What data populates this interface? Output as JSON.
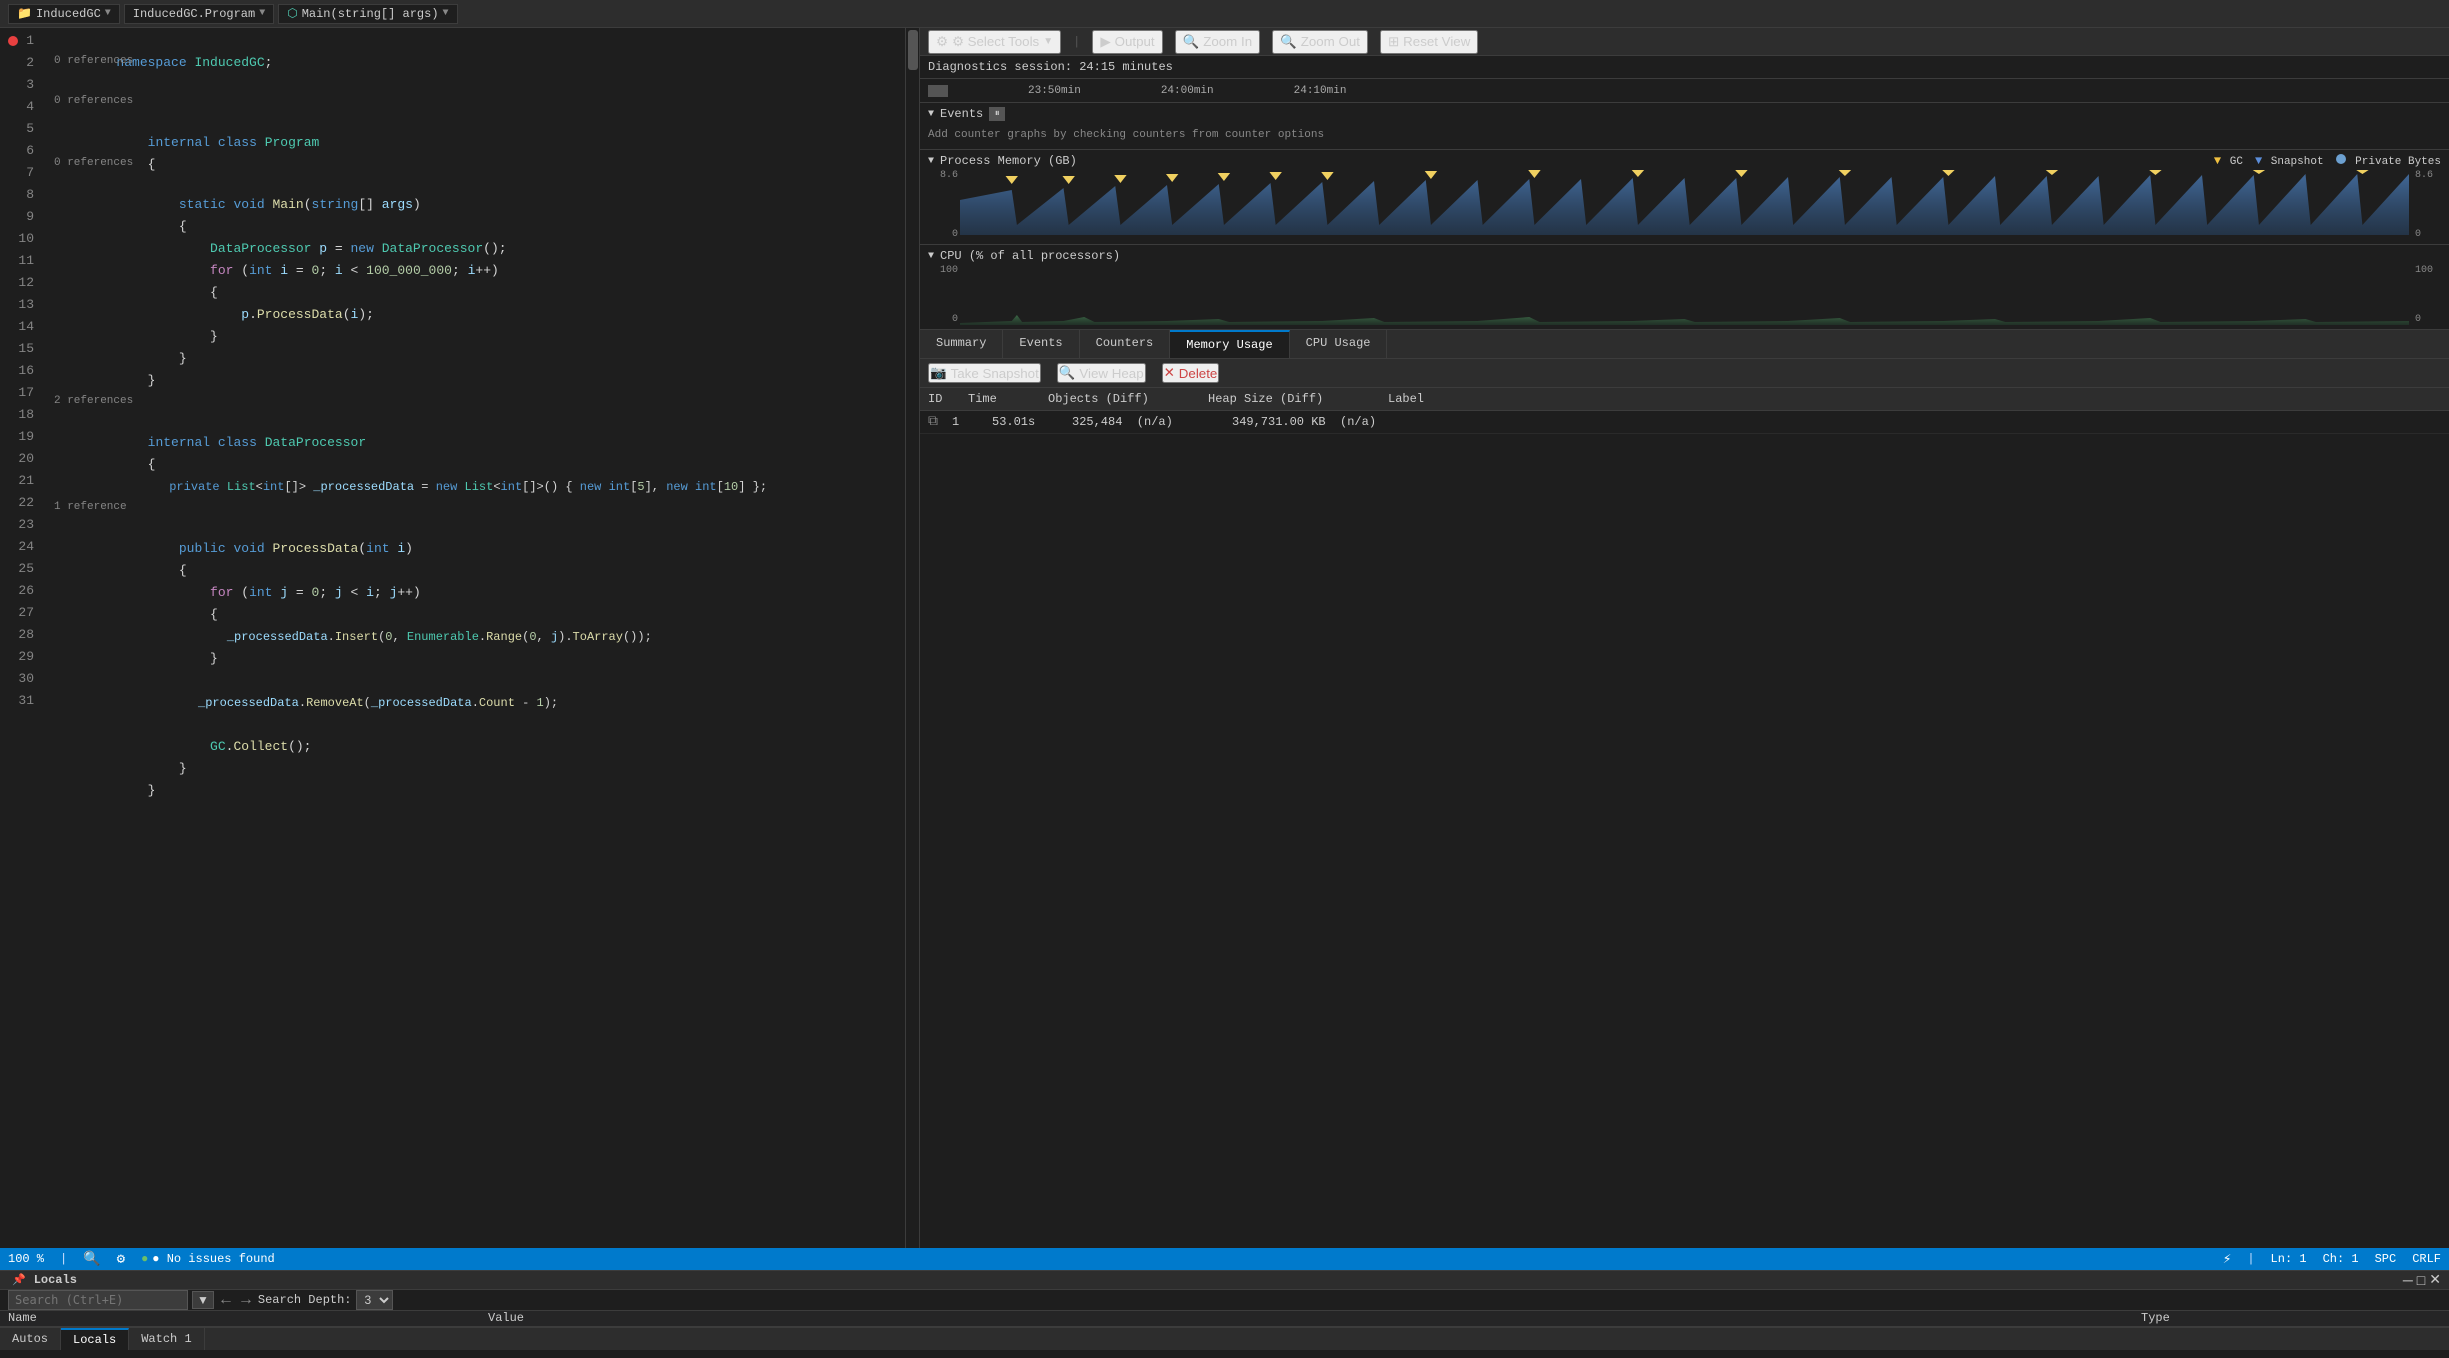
{
  "titlebar": {
    "project": "InducedGC",
    "file": "InducedGC.Program",
    "method": "Main(string[] args)"
  },
  "editor": {
    "lines": [
      {
        "num": 1,
        "tokens": [
          {
            "t": "kw",
            "v": "namespace"
          },
          {
            "t": "plain",
            "v": " "
          },
          {
            "t": "ns",
            "v": "InducedGC"
          },
          {
            "t": "plain",
            "v": ";"
          }
        ],
        "refs": null,
        "indent": 0
      },
      {
        "num": 2,
        "tokens": [],
        "refs": null
      },
      {
        "num": 3,
        "tokens": [
          {
            "t": "plain",
            "v": "    "
          },
          {
            "t": "kw",
            "v": "internal"
          },
          {
            "t": "plain",
            "v": " "
          },
          {
            "t": "kw",
            "v": "class"
          },
          {
            "t": "plain",
            "v": " "
          },
          {
            "t": "type",
            "v": "Program"
          }
        ],
        "refs": "0 references"
      },
      {
        "num": 4,
        "tokens": [
          {
            "t": "plain",
            "v": "    {"
          }
        ]
      },
      {
        "num": 5,
        "tokens": [
          {
            "t": "plain",
            "v": "        "
          },
          {
            "t": "kw",
            "v": "static"
          },
          {
            "t": "plain",
            "v": " "
          },
          {
            "t": "kw",
            "v": "void"
          },
          {
            "t": "plain",
            "v": " "
          },
          {
            "t": "method",
            "v": "Main"
          },
          {
            "t": "plain",
            "v": "("
          },
          {
            "t": "kw",
            "v": "string"
          },
          {
            "t": "plain",
            "v": "[] "
          },
          {
            "t": "param",
            "v": "args"
          },
          {
            "t": "plain",
            "v": ")"
          }
        ],
        "refs": "0 references"
      },
      {
        "num": 6,
        "tokens": [
          {
            "t": "plain",
            "v": "        {"
          }
        ]
      },
      {
        "num": 7,
        "tokens": [
          {
            "t": "plain",
            "v": "            "
          },
          {
            "t": "type",
            "v": "DataProcessor"
          },
          {
            "t": "plain",
            "v": " "
          },
          {
            "t": "param",
            "v": "p"
          },
          {
            "t": "plain",
            "v": " = "
          },
          {
            "t": "kw",
            "v": "new"
          },
          {
            "t": "plain",
            "v": " "
          },
          {
            "t": "type",
            "v": "DataProcessor"
          },
          {
            "t": "plain",
            "v": "();"
          }
        ]
      },
      {
        "num": 8,
        "tokens": [
          {
            "t": "plain",
            "v": "            "
          },
          {
            "t": "kw2",
            "v": "for"
          },
          {
            "t": "plain",
            "v": " ("
          },
          {
            "t": "kw",
            "v": "int"
          },
          {
            "t": "plain",
            "v": " "
          },
          {
            "t": "param",
            "v": "i"
          },
          {
            "t": "plain",
            "v": " = "
          },
          {
            "t": "num",
            "v": "0"
          },
          {
            "t": "plain",
            "v": "; "
          },
          {
            "t": "param",
            "v": "i"
          },
          {
            "t": "plain",
            "v": " < "
          },
          {
            "t": "num",
            "v": "100_000_000"
          },
          {
            "t": "plain",
            "v": "; "
          },
          {
            "t": "param",
            "v": "i"
          },
          {
            "t": "plain",
            "v": "++)"
          }
        ]
      },
      {
        "num": 9,
        "tokens": [
          {
            "t": "plain",
            "v": "            {"
          }
        ]
      },
      {
        "num": 10,
        "tokens": [
          {
            "t": "plain",
            "v": "                "
          },
          {
            "t": "param",
            "v": "p"
          },
          {
            "t": "plain",
            "v": "."
          },
          {
            "t": "method",
            "v": "ProcessData"
          },
          {
            "t": "plain",
            "v": "("
          },
          {
            "t": "param",
            "v": "i"
          },
          {
            "t": "plain",
            "v": ");"
          }
        ]
      },
      {
        "num": 11,
        "tokens": [
          {
            "t": "plain",
            "v": "            }"
          }
        ]
      },
      {
        "num": 12,
        "tokens": [
          {
            "t": "plain",
            "v": "        }"
          }
        ]
      },
      {
        "num": 13,
        "tokens": [
          {
            "t": "plain",
            "v": "    }"
          }
        ]
      },
      {
        "num": 14,
        "tokens": []
      },
      {
        "num": 15,
        "tokens": [
          {
            "t": "plain",
            "v": "    "
          },
          {
            "t": "kw",
            "v": "internal"
          },
          {
            "t": "plain",
            "v": " "
          },
          {
            "t": "kw",
            "v": "class"
          },
          {
            "t": "plain",
            "v": " "
          },
          {
            "t": "type",
            "v": "DataProcessor"
          }
        ],
        "refs": "2 references"
      },
      {
        "num": 16,
        "tokens": [
          {
            "t": "plain",
            "v": "    {"
          }
        ]
      },
      {
        "num": 17,
        "tokens": [
          {
            "t": "plain",
            "v": "        "
          },
          {
            "t": "kw",
            "v": "private"
          },
          {
            "t": "plain",
            "v": " "
          },
          {
            "t": "type",
            "v": "List"
          },
          {
            "t": "plain",
            "v": "<"
          },
          {
            "t": "kw",
            "v": "int"
          },
          {
            "t": "plain",
            "v": "[]> "
          },
          {
            "t": "param",
            "v": "_processedData"
          },
          {
            "t": "plain",
            "v": " = "
          },
          {
            "t": "kw",
            "v": "new"
          },
          {
            "t": "plain",
            "v": " "
          },
          {
            "t": "type",
            "v": "List"
          },
          {
            "t": "plain",
            "v": "<"
          },
          {
            "t": "kw",
            "v": "int"
          },
          {
            "t": "plain",
            "v": "[]>() { "
          },
          {
            "t": "kw",
            "v": "new"
          },
          {
            "t": "plain",
            "v": " "
          },
          {
            "t": "kw",
            "v": "int"
          },
          {
            "t": "plain",
            "v": "["
          },
          {
            "t": "num",
            "v": "5"
          },
          {
            "t": "plain",
            "v": "], "
          },
          {
            "t": "kw",
            "v": "new"
          },
          {
            "t": "plain",
            "v": " "
          },
          {
            "t": "kw",
            "v": "int"
          },
          {
            "t": "plain",
            "v": "["
          },
          {
            "t": "num",
            "v": "10"
          },
          {
            "t": "plain",
            "v": "] };"
          }
        ]
      },
      {
        "num": 18,
        "tokens": []
      },
      {
        "num": 19,
        "tokens": [
          {
            "t": "plain",
            "v": "        "
          },
          {
            "t": "kw",
            "v": "public"
          },
          {
            "t": "plain",
            "v": " "
          },
          {
            "t": "kw",
            "v": "void"
          },
          {
            "t": "plain",
            "v": " "
          },
          {
            "t": "method",
            "v": "ProcessData"
          },
          {
            "t": "plain",
            "v": "("
          },
          {
            "t": "kw",
            "v": "int"
          },
          {
            "t": "plain",
            "v": " "
          },
          {
            "t": "param",
            "v": "i"
          },
          {
            "t": "plain",
            "v": ")"
          }
        ],
        "refs": "1 reference"
      },
      {
        "num": 20,
        "tokens": [
          {
            "t": "plain",
            "v": "        {"
          }
        ]
      },
      {
        "num": 21,
        "tokens": [
          {
            "t": "plain",
            "v": "            "
          },
          {
            "t": "kw2",
            "v": "for"
          },
          {
            "t": "plain",
            "v": " ("
          },
          {
            "t": "kw",
            "v": "int"
          },
          {
            "t": "plain",
            "v": " "
          },
          {
            "t": "param",
            "v": "j"
          },
          {
            "t": "plain",
            "v": " = "
          },
          {
            "t": "num",
            "v": "0"
          },
          {
            "t": "plain",
            "v": "; "
          },
          {
            "t": "param",
            "v": "j"
          },
          {
            "t": "plain",
            "v": " < "
          },
          {
            "t": "param",
            "v": "i"
          },
          {
            "t": "plain",
            "v": "; "
          },
          {
            "t": "param",
            "v": "j"
          },
          {
            "t": "plain",
            "v": "++)"
          }
        ]
      },
      {
        "num": 22,
        "tokens": [
          {
            "t": "plain",
            "v": "            {"
          }
        ]
      },
      {
        "num": 23,
        "tokens": [
          {
            "t": "plain",
            "v": "                "
          },
          {
            "t": "param",
            "v": "_processedData"
          },
          {
            "t": "plain",
            "v": "."
          },
          {
            "t": "method",
            "v": "Insert"
          },
          {
            "t": "plain",
            "v": "("
          },
          {
            "t": "num",
            "v": "0"
          },
          {
            "t": "plain",
            "v": ", "
          },
          {
            "t": "type",
            "v": "Enumerable"
          },
          {
            "t": "plain",
            "v": "."
          },
          {
            "t": "method",
            "v": "Range"
          },
          {
            "t": "plain",
            "v": "("
          },
          {
            "t": "num",
            "v": "0"
          },
          {
            "t": "plain",
            "v": ", "
          },
          {
            "t": "param",
            "v": "j"
          },
          {
            "t": "plain",
            "v": ")."
          },
          {
            "t": "method",
            "v": "ToArray"
          },
          {
            "t": "plain",
            "v": "());"
          }
        ]
      },
      {
        "num": 24,
        "tokens": [
          {
            "t": "plain",
            "v": "            }"
          }
        ]
      },
      {
        "num": 25,
        "tokens": []
      },
      {
        "num": 26,
        "tokens": [
          {
            "t": "plain",
            "v": "            "
          },
          {
            "t": "param",
            "v": "_processedData"
          },
          {
            "t": "plain",
            "v": "."
          },
          {
            "t": "method",
            "v": "RemoveAt"
          },
          {
            "t": "plain",
            "v": "("
          },
          {
            "t": "param",
            "v": "_processedData"
          },
          {
            "t": "plain",
            "v": "."
          },
          {
            "t": "method",
            "v": "Count"
          },
          {
            "t": "plain",
            "v": " - "
          },
          {
            "t": "num",
            "v": "1"
          },
          {
            "t": "plain",
            "v": ");"
          }
        ]
      },
      {
        "num": 27,
        "tokens": []
      },
      {
        "num": 28,
        "tokens": [
          {
            "t": "plain",
            "v": "            "
          },
          {
            "t": "type",
            "v": "GC"
          },
          {
            "t": "plain",
            "v": "."
          },
          {
            "t": "method",
            "v": "Collect"
          },
          {
            "t": "plain",
            "v": "();"
          }
        ]
      },
      {
        "num": 29,
        "tokens": [
          {
            "t": "plain",
            "v": "        }"
          }
        ]
      },
      {
        "num": 30,
        "tokens": [
          {
            "t": "plain",
            "v": "    }"
          }
        ]
      },
      {
        "num": 31,
        "tokens": []
      }
    ]
  },
  "diag": {
    "toolbar": {
      "select_tools": "⚙ Select Tools",
      "output": "▶ Output",
      "zoom_in": "🔍 Zoom In",
      "zoom_out": "🔍 Zoom Out",
      "reset_view": "⊞ Reset View"
    },
    "session_label": "Diagnostics session: 24:15 minutes",
    "timeline": {
      "t1": "23:50min",
      "t2": "24:00min",
      "t3": "24:10min"
    },
    "events": {
      "header": "Events",
      "hint": "Add counter graphs by checking counters from counter options"
    },
    "process_memory": {
      "header": "Process Memory (GB)",
      "legend_gc": "GC",
      "legend_snapshot": "Snapshot",
      "legend_private": "Private Bytes",
      "max_val": "8.6",
      "min_val": "0",
      "max_val_right": "8.6",
      "min_val_right": "0"
    },
    "cpu": {
      "header": "CPU (% of all processors)",
      "max_val": "100",
      "min_val": "0",
      "max_val_right": "100",
      "min_val_right": "0"
    },
    "tabs": {
      "summary": "Summary",
      "events": "Events",
      "counters": "Counters",
      "memory_usage": "Memory Usage",
      "cpu_usage": "CPU Usage"
    },
    "memory_toolbar": {
      "take_snapshot": "Take Snapshot",
      "view_heap": "View Heap",
      "delete": "Delete"
    },
    "table": {
      "headers": {
        "id": "ID",
        "time": "Time",
        "objects": "Objects (Diff)",
        "heap_size": "Heap Size (Diff)",
        "label": "Label"
      },
      "rows": [
        {
          "id": "1",
          "time": "53.01s",
          "objects": "325,484  (n/a)",
          "heap_size": "349,731.00 KB  (n/a)",
          "label": ""
        }
      ]
    }
  },
  "statusbar": {
    "zoom": "100 %",
    "no_issues": "● No issues found",
    "ln": "Ln: 1",
    "ch": "Ch: 1",
    "spc": "SPC",
    "crlf": "CRLF"
  },
  "locals": {
    "title": "Locals",
    "search_placeholder": "Search (Ctrl+E)",
    "search_depth_label": "Search Depth:",
    "nav_back": "←",
    "nav_forward": "→",
    "cols": {
      "name": "Name",
      "value": "Value",
      "type": "Type"
    },
    "tabs": {
      "autos": "Autos",
      "locals": "Locals",
      "watch1": "Watch 1"
    }
  }
}
